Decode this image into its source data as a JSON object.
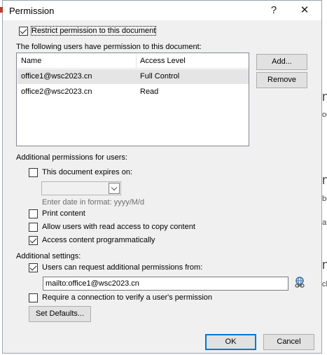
{
  "window": {
    "title": "Permission",
    "help_label": "?",
    "close_label": "✕"
  },
  "restrict": {
    "label": "Restrict permission to this document",
    "checked": true
  },
  "users_section": {
    "label": "The following users have permission to this document:",
    "columns": [
      "Name",
      "Access Level"
    ],
    "rows": [
      {
        "name": "office1@wsc2023.cn",
        "access": "Full Control",
        "selected": true
      },
      {
        "name": "office2@wsc2023.cn",
        "access": "Read",
        "selected": false
      }
    ],
    "add_label": "Add...",
    "remove_label": "Remove"
  },
  "additional_permissions": {
    "label": "Additional permissions for users:",
    "expires": {
      "label": "This document expires on:",
      "checked": false
    },
    "date_hint": "Enter date in format: yyyy/M/d",
    "print": {
      "label": "Print content",
      "checked": false
    },
    "copy": {
      "label": "Allow users with read access to copy content",
      "checked": false
    },
    "programmatic": {
      "label": "Access content programmatically",
      "checked": true
    }
  },
  "additional_settings": {
    "label": "Additional settings:",
    "request": {
      "label": "Users can request additional permissions from:",
      "checked": true
    },
    "request_value": "mailto:office1@wsc2023.cn",
    "verify": {
      "label": "Require a connection to verify a user's permission",
      "checked": false
    },
    "defaults_label": "Set Defaults..."
  },
  "footer": {
    "ok_label": "OK",
    "cancel_label": "Cancel"
  },
  "background_text": [
    "nt",
    "og",
    "nt",
    "be",
    "ar",
    "n",
    "cl"
  ],
  "colors": {
    "accent": "#0078d7",
    "dialog_bg": "#f0f0f0",
    "selected_row": "#e5e5e5"
  }
}
